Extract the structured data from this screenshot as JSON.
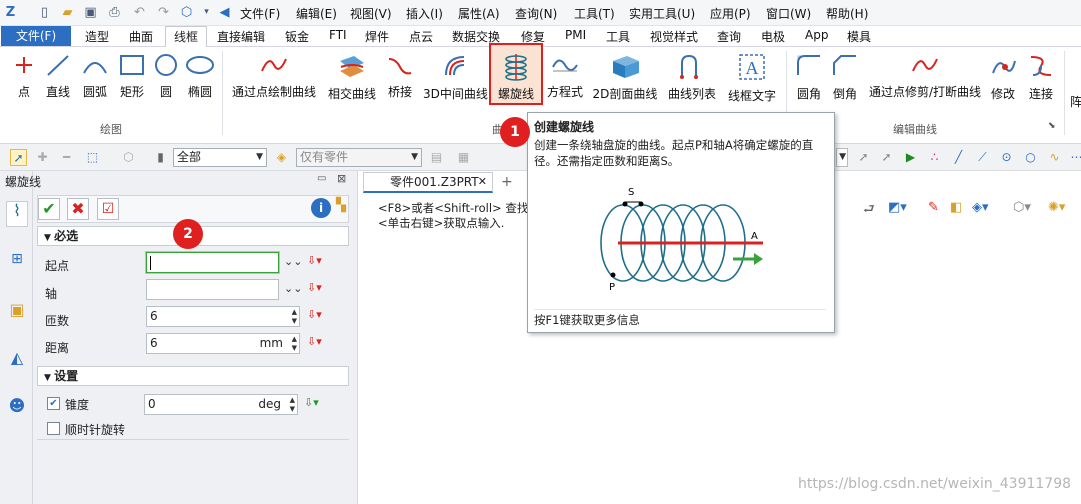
{
  "menu": [
    "文件(F)",
    "编辑(E)",
    "视图(V)",
    "插入(I)",
    "属性(A)",
    "查询(N)",
    "工具(T)",
    "实用工具(U)",
    "应用(P)",
    "窗口(W)",
    "帮助(H)"
  ],
  "tabs": {
    "file": "文件(F)",
    "items": [
      "造型",
      "曲面",
      "线框",
      "直接编辑",
      "钣金",
      "FTI",
      "焊件",
      "点云",
      "数据交换",
      "修复",
      "PMI",
      "工具",
      "视觉样式",
      "查询",
      "电极",
      "App",
      "模具"
    ],
    "active": "线框"
  },
  "ribbon": {
    "draw": [
      "点",
      "直线",
      "圆弧",
      "矩形",
      "圆",
      "椭圆"
    ],
    "curve": [
      "通过点绘制曲线",
      "相交曲线",
      "桥接",
      "3D中间曲线",
      "螺旋线",
      "方程式",
      "2D剖面曲线",
      "曲线列表",
      "线框文字"
    ],
    "edit": [
      "圆角",
      "倒角",
      "通过点修剪/打断曲线",
      "修改",
      "连接"
    ],
    "edge_partial": "阵",
    "groups": {
      "draw": "绘图",
      "curve_partial": "曲",
      "edit": "编辑曲线"
    }
  },
  "toolbar2": {
    "filter": "全部",
    "parts": "仅有零件"
  },
  "panel": {
    "title": "螺旋线",
    "section_required": "必选",
    "fields": [
      {
        "label": "起点",
        "value": ""
      },
      {
        "label": "轴",
        "value": ""
      },
      {
        "label": "匝数",
        "value": "6"
      },
      {
        "label": "距离",
        "value": "6",
        "unit": "mm"
      }
    ],
    "section_settings": "设置",
    "taper": {
      "label": "锥度",
      "value": "0",
      "unit": "deg",
      "checked": true
    },
    "clockwise": {
      "label": "顺时针旋转",
      "checked": false
    }
  },
  "document": {
    "tab": "零件001.Z3PRT",
    "hint1": "<F8>或者<Shift-roll> 查找下",
    "hint2": "<单击右键>获取点输入."
  },
  "tooltip": {
    "title": "创建螺旋线",
    "desc": "创建一条绕轴盘旋的曲线。起点P和轴A将确定螺旋的直径。还需指定匝数和距离S。",
    "footer": "按F1键获取更多信息",
    "fig_labels": {
      "s": "S",
      "a": "A",
      "p": "P"
    }
  },
  "markers": [
    "1",
    "2"
  ],
  "watermark": "https://blog.csdn.net/weixin_43911798",
  "colors": {
    "accent": "#2b6ec2",
    "highlight": "#e02020",
    "helix": "#1f6f8b"
  }
}
